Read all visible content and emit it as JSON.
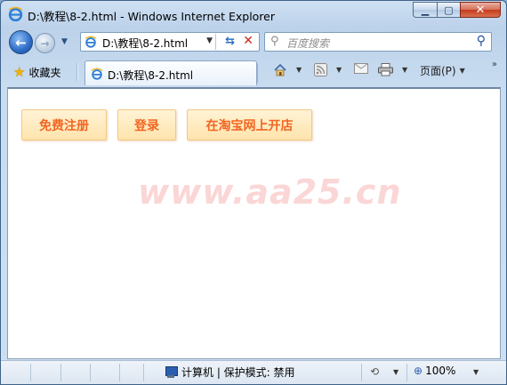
{
  "window": {
    "title": "D:\\教程\\8-2.html - Windows Internet Explorer"
  },
  "nav": {
    "address": "D:\\教程\\8-2.html",
    "search_placeholder": "百度搜索"
  },
  "toolbar": {
    "favorites_label": "收藏夹",
    "tab_title": "D:\\教程\\8-2.html",
    "page_menu_label": "页面(P)"
  },
  "content": {
    "buttons": [
      {
        "label": "免费注册"
      },
      {
        "label": "登录"
      },
      {
        "label": "在淘宝网上开店"
      }
    ],
    "watermark": "www.aa25.cn",
    "button_text_color": "#f26522",
    "button_bg_color": "#ffe4ac"
  },
  "status": {
    "zone_text": "计算机 | 保护模式: 禁用",
    "zoom": "100%"
  }
}
